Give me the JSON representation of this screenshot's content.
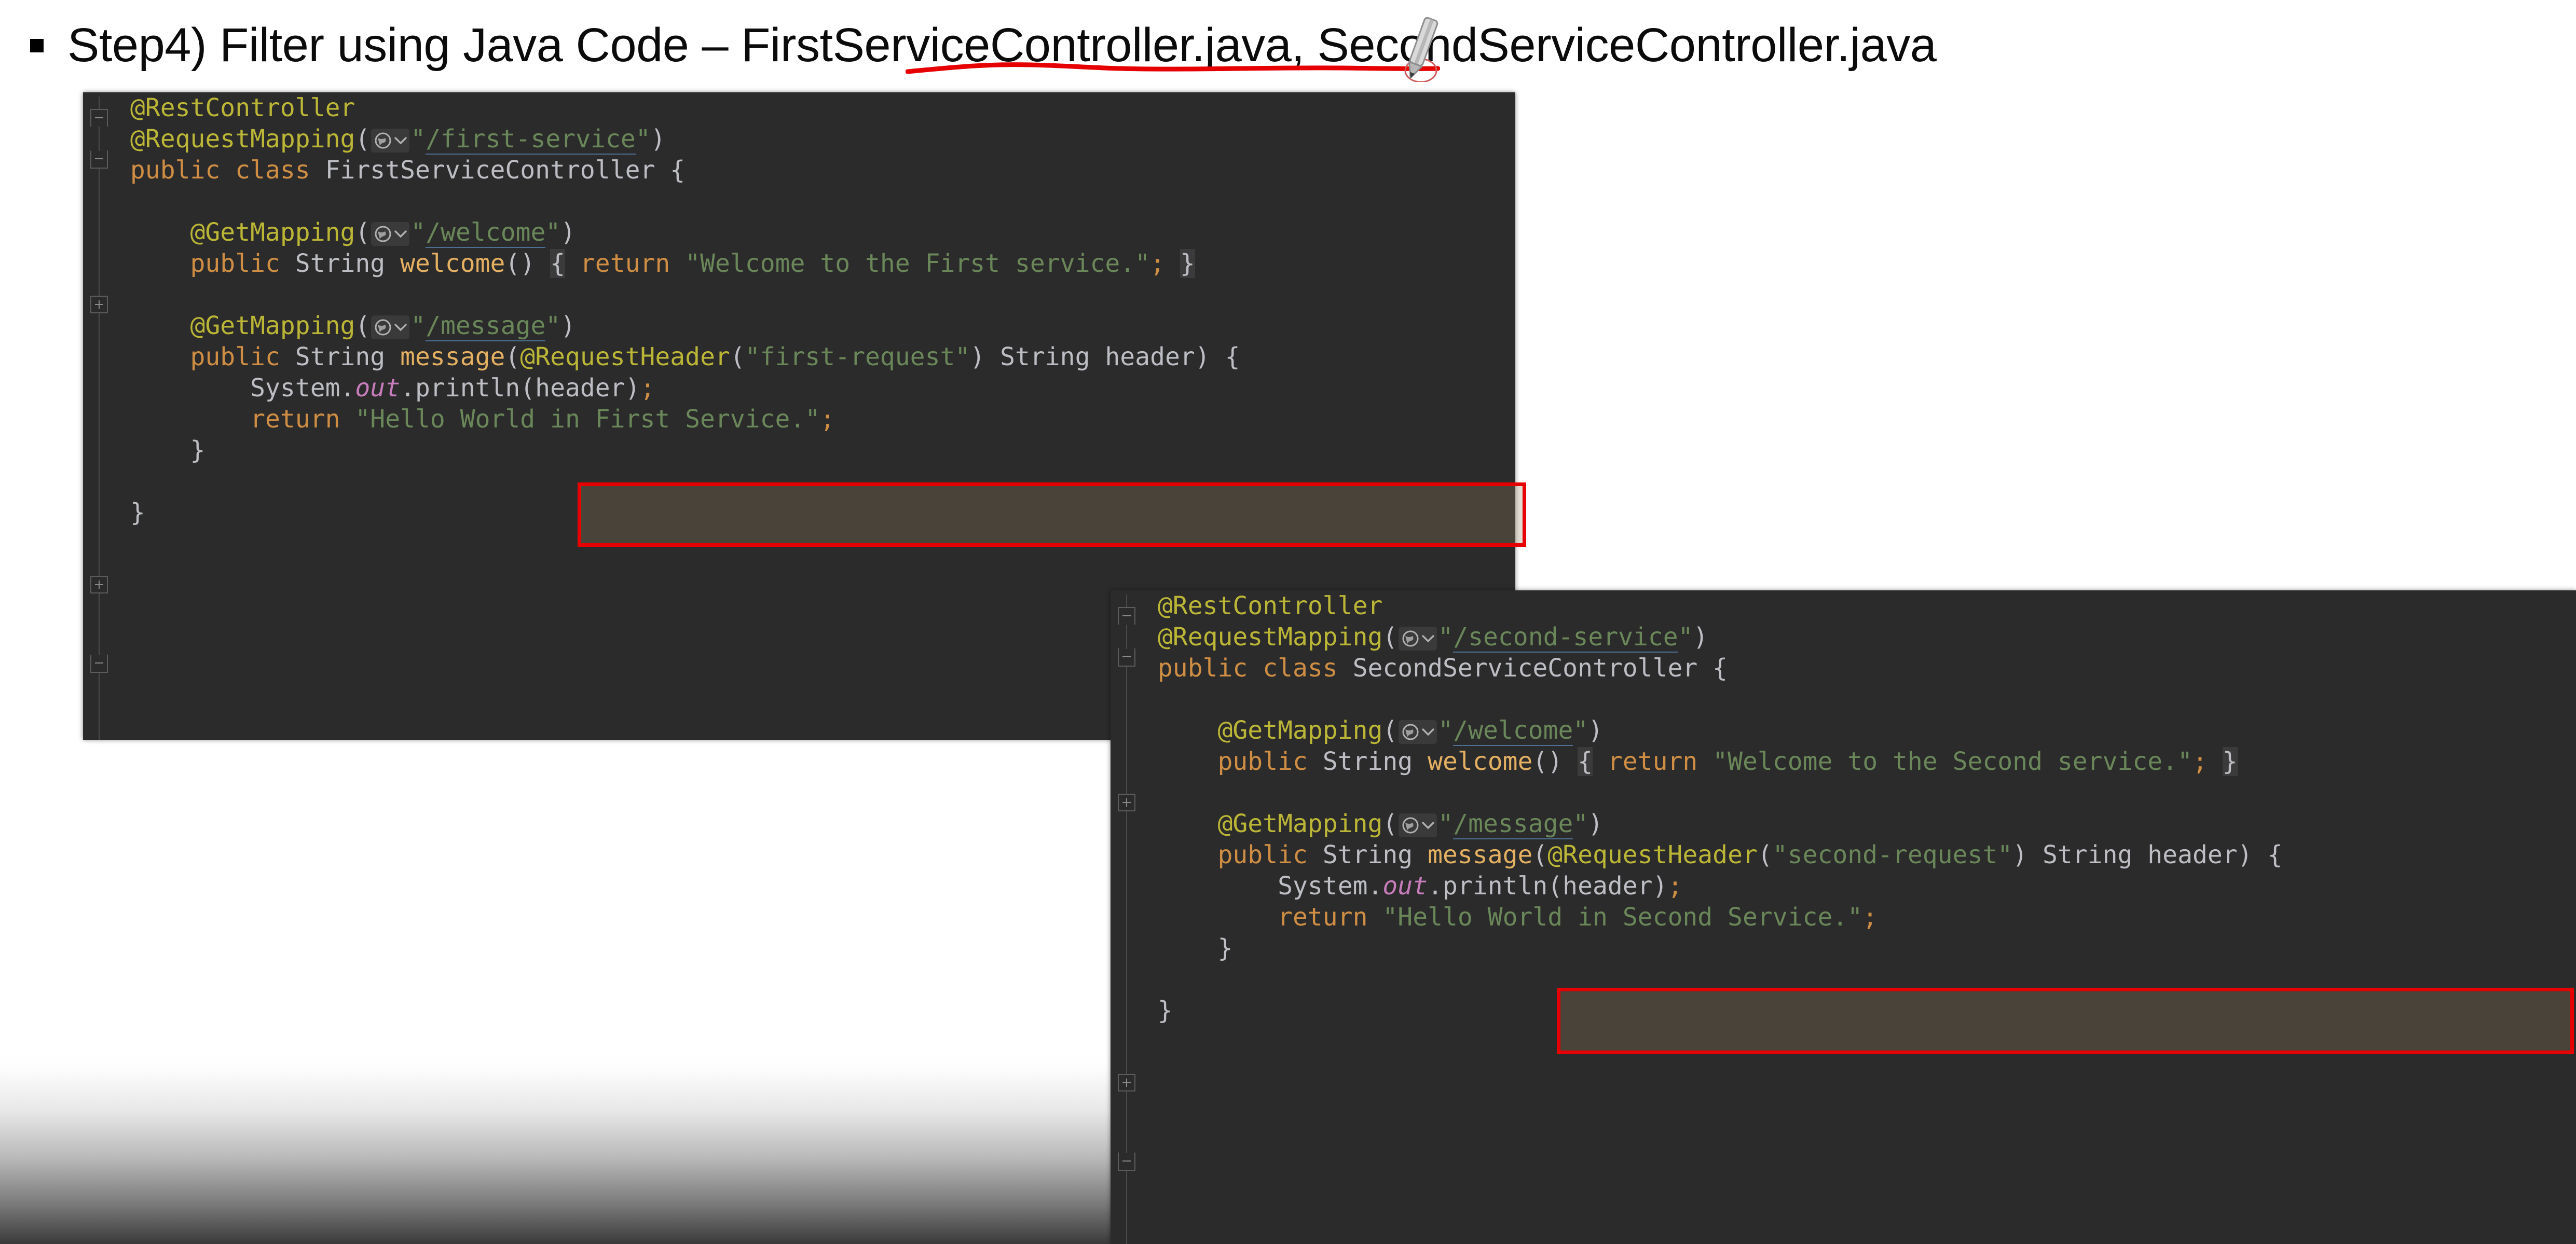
{
  "slide": {
    "bullet_glyph": "square-bullet",
    "title": "Step4) Filter using Java Code – FirstServiceController.java, SecondServiceController.java",
    "annotations": {
      "underline_color": "#e60000",
      "underline_target": "FirstServiceController",
      "cursor": "pen-cursor"
    }
  },
  "accent_colors": {
    "highlight_box": "#e60000",
    "editor_background": "#2b2b2b",
    "annotation": "#bcb637",
    "keyword": "#cf8e44",
    "string": "#6a8759",
    "method": "#e4b062",
    "identifier": "#bcbec4",
    "static_field": "#c77dbb"
  },
  "editors": [
    {
      "id": "first-service-controller",
      "file_label": "FirstServiceController.java",
      "gutter_icon": "globe-icon",
      "chevron_icon": "chevron-down-icon",
      "lines": [
        {
          "n": 1,
          "indent": 0,
          "tokens": [
            {
              "t": "anno",
              "v": "@RestController"
            }
          ]
        },
        {
          "n": 2,
          "indent": 0,
          "tokens": [
            {
              "t": "anno",
              "v": "@RequestMapping"
            },
            {
              "t": "punc",
              "v": "("
            },
            {
              "t": "badge",
              "v": "globe-chevron"
            },
            {
              "t": "str",
              "v": "\""
            },
            {
              "t": "url",
              "v": "/first-service"
            },
            {
              "t": "str",
              "v": "\""
            },
            {
              "t": "punc",
              "v": ")"
            }
          ]
        },
        {
          "n": 3,
          "indent": 0,
          "tokens": [
            {
              "t": "kw",
              "v": "public class"
            },
            {
              "t": "plain",
              "v": " "
            },
            {
              "t": "type",
              "v": "FirstServiceController"
            },
            {
              "t": "plain",
              "v": " "
            },
            {
              "t": "punc",
              "v": "{"
            }
          ]
        },
        {
          "n": 4,
          "indent": 0,
          "tokens": []
        },
        {
          "n": 5,
          "indent": 1,
          "tokens": [
            {
              "t": "anno",
              "v": "@GetMapping"
            },
            {
              "t": "punc",
              "v": "("
            },
            {
              "t": "badge",
              "v": "globe-chevron"
            },
            {
              "t": "str",
              "v": "\""
            },
            {
              "t": "url",
              "v": "/welcome"
            },
            {
              "t": "str",
              "v": "\""
            },
            {
              "t": "punc",
              "v": ")"
            }
          ]
        },
        {
          "n": 6,
          "indent": 1,
          "tokens": [
            {
              "t": "kw",
              "v": "public"
            },
            {
              "t": "plain",
              "v": " "
            },
            {
              "t": "type",
              "v": "String"
            },
            {
              "t": "plain",
              "v": " "
            },
            {
              "t": "method",
              "v": "welcome"
            },
            {
              "t": "punc",
              "v": "()"
            },
            {
              "t": "plain",
              "v": " "
            },
            {
              "t": "brace",
              "v": "{"
            },
            {
              "t": "plain",
              "v": " "
            },
            {
              "t": "kw",
              "v": "return"
            },
            {
              "t": "plain",
              "v": " "
            },
            {
              "t": "str",
              "v": "\"Welcome to the First service.\""
            },
            {
              "t": "semi",
              "v": ";"
            },
            {
              "t": "plain",
              "v": " "
            },
            {
              "t": "brace",
              "v": "}"
            }
          ]
        },
        {
          "n": 7,
          "indent": 0,
          "tokens": []
        },
        {
          "n": 8,
          "indent": 1,
          "tokens": [
            {
              "t": "anno",
              "v": "@GetMapping"
            },
            {
              "t": "punc",
              "v": "("
            },
            {
              "t": "badge",
              "v": "globe-chevron"
            },
            {
              "t": "str",
              "v": "\""
            },
            {
              "t": "url",
              "v": "/message"
            },
            {
              "t": "str",
              "v": "\""
            },
            {
              "t": "punc",
              "v": ")"
            }
          ]
        },
        {
          "n": 9,
          "indent": 1,
          "highlighted": true,
          "tokens": [
            {
              "t": "kw",
              "v": "public"
            },
            {
              "t": "plain",
              "v": " "
            },
            {
              "t": "type",
              "v": "String"
            },
            {
              "t": "plain",
              "v": " "
            },
            {
              "t": "method",
              "v": "message"
            },
            {
              "t": "punc",
              "v": "("
            },
            {
              "t": "anno",
              "v": "@RequestHeader"
            },
            {
              "t": "punc",
              "v": "("
            },
            {
              "t": "str",
              "v": "\"first-request\""
            },
            {
              "t": "punc",
              "v": ")"
            },
            {
              "t": "plain",
              "v": " "
            },
            {
              "t": "type",
              "v": "String"
            },
            {
              "t": "plain",
              "v": " "
            },
            {
              "t": "plain",
              "v": "header"
            },
            {
              "t": "punc",
              "v": ")"
            },
            {
              "t": "plain",
              "v": " "
            },
            {
              "t": "punc",
              "v": "{"
            }
          ]
        },
        {
          "n": 10,
          "indent": 2,
          "tokens": [
            {
              "t": "plain",
              "v": "System."
            },
            {
              "t": "stat",
              "v": "out"
            },
            {
              "t": "plain",
              "v": ".println(header)"
            },
            {
              "t": "semi",
              "v": ";"
            }
          ]
        },
        {
          "n": 11,
          "indent": 2,
          "tokens": [
            {
              "t": "kw",
              "v": "return"
            },
            {
              "t": "plain",
              "v": " "
            },
            {
              "t": "str",
              "v": "\"Hello World in First Service.\""
            },
            {
              "t": "semi",
              "v": ";"
            }
          ]
        },
        {
          "n": 12,
          "indent": 1,
          "tokens": [
            {
              "t": "punc",
              "v": "}"
            }
          ]
        },
        {
          "n": 13,
          "indent": 0,
          "tokens": []
        },
        {
          "n": 14,
          "indent": 0,
          "tokens": [
            {
              "t": "punc",
              "v": "}"
            }
          ]
        }
      ]
    },
    {
      "id": "second-service-controller",
      "file_label": "SecondServiceController.java",
      "gutter_icon": "globe-icon",
      "chevron_icon": "chevron-down-icon",
      "lines": [
        {
          "n": 1,
          "indent": 0,
          "tokens": [
            {
              "t": "anno",
              "v": "@RestController"
            }
          ]
        },
        {
          "n": 2,
          "indent": 0,
          "tokens": [
            {
              "t": "anno",
              "v": "@RequestMapping"
            },
            {
              "t": "punc",
              "v": "("
            },
            {
              "t": "badge",
              "v": "globe-chevron"
            },
            {
              "t": "str",
              "v": "\""
            },
            {
              "t": "url",
              "v": "/second-service"
            },
            {
              "t": "str",
              "v": "\""
            },
            {
              "t": "punc",
              "v": ")"
            }
          ]
        },
        {
          "n": 3,
          "indent": 0,
          "tokens": [
            {
              "t": "kw",
              "v": "public class"
            },
            {
              "t": "plain",
              "v": " "
            },
            {
              "t": "type",
              "v": "SecondServiceController"
            },
            {
              "t": "plain",
              "v": " "
            },
            {
              "t": "punc",
              "v": "{"
            }
          ]
        },
        {
          "n": 4,
          "indent": 0,
          "tokens": []
        },
        {
          "n": 5,
          "indent": 1,
          "tokens": [
            {
              "t": "anno",
              "v": "@GetMapping"
            },
            {
              "t": "punc",
              "v": "("
            },
            {
              "t": "badge",
              "v": "globe-chevron"
            },
            {
              "t": "str",
              "v": "\""
            },
            {
              "t": "url",
              "v": "/welcome"
            },
            {
              "t": "str",
              "v": "\""
            },
            {
              "t": "punc",
              "v": ")"
            }
          ]
        },
        {
          "n": 6,
          "indent": 1,
          "tokens": [
            {
              "t": "kw",
              "v": "public"
            },
            {
              "t": "plain",
              "v": " "
            },
            {
              "t": "type",
              "v": "String"
            },
            {
              "t": "plain",
              "v": " "
            },
            {
              "t": "method",
              "v": "welcome"
            },
            {
              "t": "punc",
              "v": "()"
            },
            {
              "t": "plain",
              "v": " "
            },
            {
              "t": "brace",
              "v": "{"
            },
            {
              "t": "plain",
              "v": " "
            },
            {
              "t": "kw",
              "v": "return"
            },
            {
              "t": "plain",
              "v": " "
            },
            {
              "t": "str",
              "v": "\"Welcome to the Second service.\""
            },
            {
              "t": "semi",
              "v": ";"
            },
            {
              "t": "plain",
              "v": " "
            },
            {
              "t": "brace",
              "v": "}"
            }
          ]
        },
        {
          "n": 7,
          "indent": 0,
          "tokens": []
        },
        {
          "n": 8,
          "indent": 1,
          "tokens": [
            {
              "t": "anno",
              "v": "@GetMapping"
            },
            {
              "t": "punc",
              "v": "("
            },
            {
              "t": "badge",
              "v": "globe-chevron"
            },
            {
              "t": "str",
              "v": "\""
            },
            {
              "t": "url",
              "v": "/message"
            },
            {
              "t": "str",
              "v": "\""
            },
            {
              "t": "punc",
              "v": ")"
            }
          ]
        },
        {
          "n": 9,
          "indent": 1,
          "highlighted": true,
          "tokens": [
            {
              "t": "kw",
              "v": "public"
            },
            {
              "t": "plain",
              "v": " "
            },
            {
              "t": "type",
              "v": "String"
            },
            {
              "t": "plain",
              "v": " "
            },
            {
              "t": "method",
              "v": "message"
            },
            {
              "t": "punc",
              "v": "("
            },
            {
              "t": "anno",
              "v": "@RequestHeader"
            },
            {
              "t": "punc",
              "v": "("
            },
            {
              "t": "str",
              "v": "\"second-request\""
            },
            {
              "t": "punc",
              "v": ")"
            },
            {
              "t": "plain",
              "v": " "
            },
            {
              "t": "type",
              "v": "String"
            },
            {
              "t": "plain",
              "v": " "
            },
            {
              "t": "plain",
              "v": "header"
            },
            {
              "t": "punc",
              "v": ")"
            },
            {
              "t": "plain",
              "v": " "
            },
            {
              "t": "punc",
              "v": "{"
            }
          ]
        },
        {
          "n": 10,
          "indent": 2,
          "tokens": [
            {
              "t": "plain",
              "v": "System."
            },
            {
              "t": "stat",
              "v": "out"
            },
            {
              "t": "plain",
              "v": ".println(header)"
            },
            {
              "t": "semi",
              "v": ";"
            }
          ]
        },
        {
          "n": 11,
          "indent": 2,
          "tokens": [
            {
              "t": "kw",
              "v": "return"
            },
            {
              "t": "plain",
              "v": " "
            },
            {
              "t": "str",
              "v": "\"Hello World in Second Service.\""
            },
            {
              "t": "semi",
              "v": ";"
            }
          ]
        },
        {
          "n": 12,
          "indent": 1,
          "tokens": [
            {
              "t": "punc",
              "v": "}"
            }
          ]
        },
        {
          "n": 13,
          "indent": 0,
          "tokens": []
        },
        {
          "n": 14,
          "indent": 0,
          "tokens": [
            {
              "t": "punc",
              "v": "}"
            }
          ]
        }
      ]
    }
  ]
}
